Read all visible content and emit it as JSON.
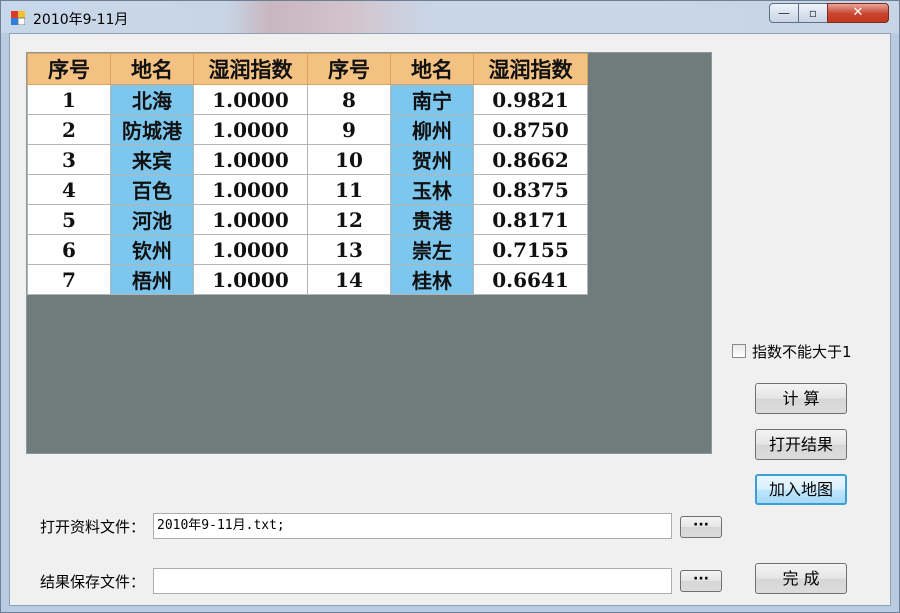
{
  "window": {
    "title": "2010年9-11月",
    "min_label": "—",
    "max_label": "▫",
    "close_label": "✕"
  },
  "grid": {
    "headers": [
      "序号",
      "地名",
      "湿润指数",
      "序号",
      "地名",
      "湿润指数"
    ],
    "rows": [
      [
        "1",
        "北海",
        "1.0000",
        "8",
        "南宁",
        "0.9821"
      ],
      [
        "2",
        "防城港",
        "1.0000",
        "9",
        "柳州",
        "0.8750"
      ],
      [
        "3",
        "来宾",
        "1.0000",
        "10",
        "贺州",
        "0.8662"
      ],
      [
        "4",
        "百色",
        "1.0000",
        "11",
        "玉林",
        "0.8375"
      ],
      [
        "5",
        "河池",
        "1.0000",
        "12",
        "贵港",
        "0.8171"
      ],
      [
        "6",
        "钦州",
        "1.0000",
        "13",
        "崇左",
        "0.7155"
      ],
      [
        "7",
        "梧州",
        "1.0000",
        "14",
        "桂林",
        "0.6641"
      ]
    ]
  },
  "options": {
    "cap_checkbox_label": "指数不能大于1",
    "cap_checked": false
  },
  "buttons": {
    "calculate": "计  算",
    "open_result": "打开结果",
    "add_map": "加入地图",
    "finish": "完  成",
    "browse": "···"
  },
  "files": {
    "input_label": "打开资料文件：",
    "input_value": "2010年9-11月.txt;",
    "output_label": "结果保存文件：",
    "output_value": ""
  },
  "colors": {
    "header_bg": "#f3c283",
    "place_bg": "#7dc6ee",
    "grid_bg": "#6e7d7b",
    "focus_border": "#3c9fd4"
  }
}
